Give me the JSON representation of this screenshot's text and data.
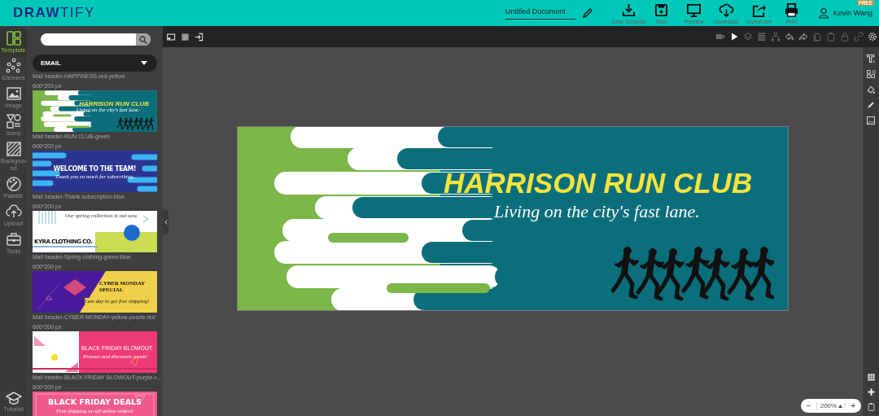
{
  "header": {
    "logo": "**DRAW**TIFY",
    "document_title": "Untitled Document",
    "actions": [
      {
        "label": "Save Template"
      },
      {
        "label": "Save"
      },
      {
        "label": "Preview"
      },
      {
        "label": "Download"
      },
      {
        "label": "Export Ani"
      },
      {
        "label": "Print"
      }
    ],
    "user": {
      "name": "Kevin Wang",
      "badge": "FREE"
    }
  },
  "sidebar": {
    "items": [
      {
        "label": "Template",
        "selected": true
      },
      {
        "label": "Element",
        "selected": false
      },
      {
        "label": "Image",
        "selected": false
      },
      {
        "label": "Icons",
        "selected": false
      },
      {
        "label": "Background",
        "selected": false
      },
      {
        "label": "Palette",
        "selected": false
      },
      {
        "label": "Upload",
        "selected": false
      },
      {
        "label": "Tools",
        "selected": false
      }
    ],
    "tutorial": "Tutorial"
  },
  "panel": {
    "category": "EMAIL",
    "scrolled_item": {
      "name": "Mail header-HAPPINESS-red-yellow",
      "size": "600*200 px"
    },
    "templates": [
      {
        "kind": "run",
        "name": "Mail header-RUN CLUB-green",
        "size": "600*200 px",
        "title": "HARRISON RUN CLUB",
        "subtitle": "Living on the city's fast lane."
      },
      {
        "kind": "welcome",
        "name": "Mail header-Thank subscription-blue",
        "size": "600*200 px",
        "title": "WELCOME TO THE TEAM!",
        "subtitle": "Thank you so much for subscribing."
      },
      {
        "kind": "spring",
        "name": "Mail header-Spring clothing-green-blue",
        "size": "600*200 px",
        "title": "KYRA CLOTHING CO.",
        "subtitle": "Our spring collection is out now."
      },
      {
        "kind": "cyber",
        "name": "Mail header-CYBER MONDAY-yellow-purple-red",
        "size": "600*200 px",
        "title": "CYBER MONDAY SPECIAL",
        "subtitle": "Last day to get free shipping!"
      },
      {
        "kind": "blowout",
        "name": "Mail header-BLACK FRIDAY BLOWOUT-purple-r...",
        "size": "600*200 px",
        "title": "BLACK FRIDAY BLOWOUT",
        "subtitle": "Promos and discounts await!"
      },
      {
        "kind": "deals",
        "title": "BLACK FRIDAY DEALS",
        "subtitle": "Free shipping on all online orders!"
      }
    ]
  },
  "canvas": {
    "title": "HARRISON RUN CLUB",
    "subtitle": "Living on the city's fast lane."
  },
  "zoom": {
    "decrease": "−",
    "value": "200%",
    "increase": "+"
  }
}
